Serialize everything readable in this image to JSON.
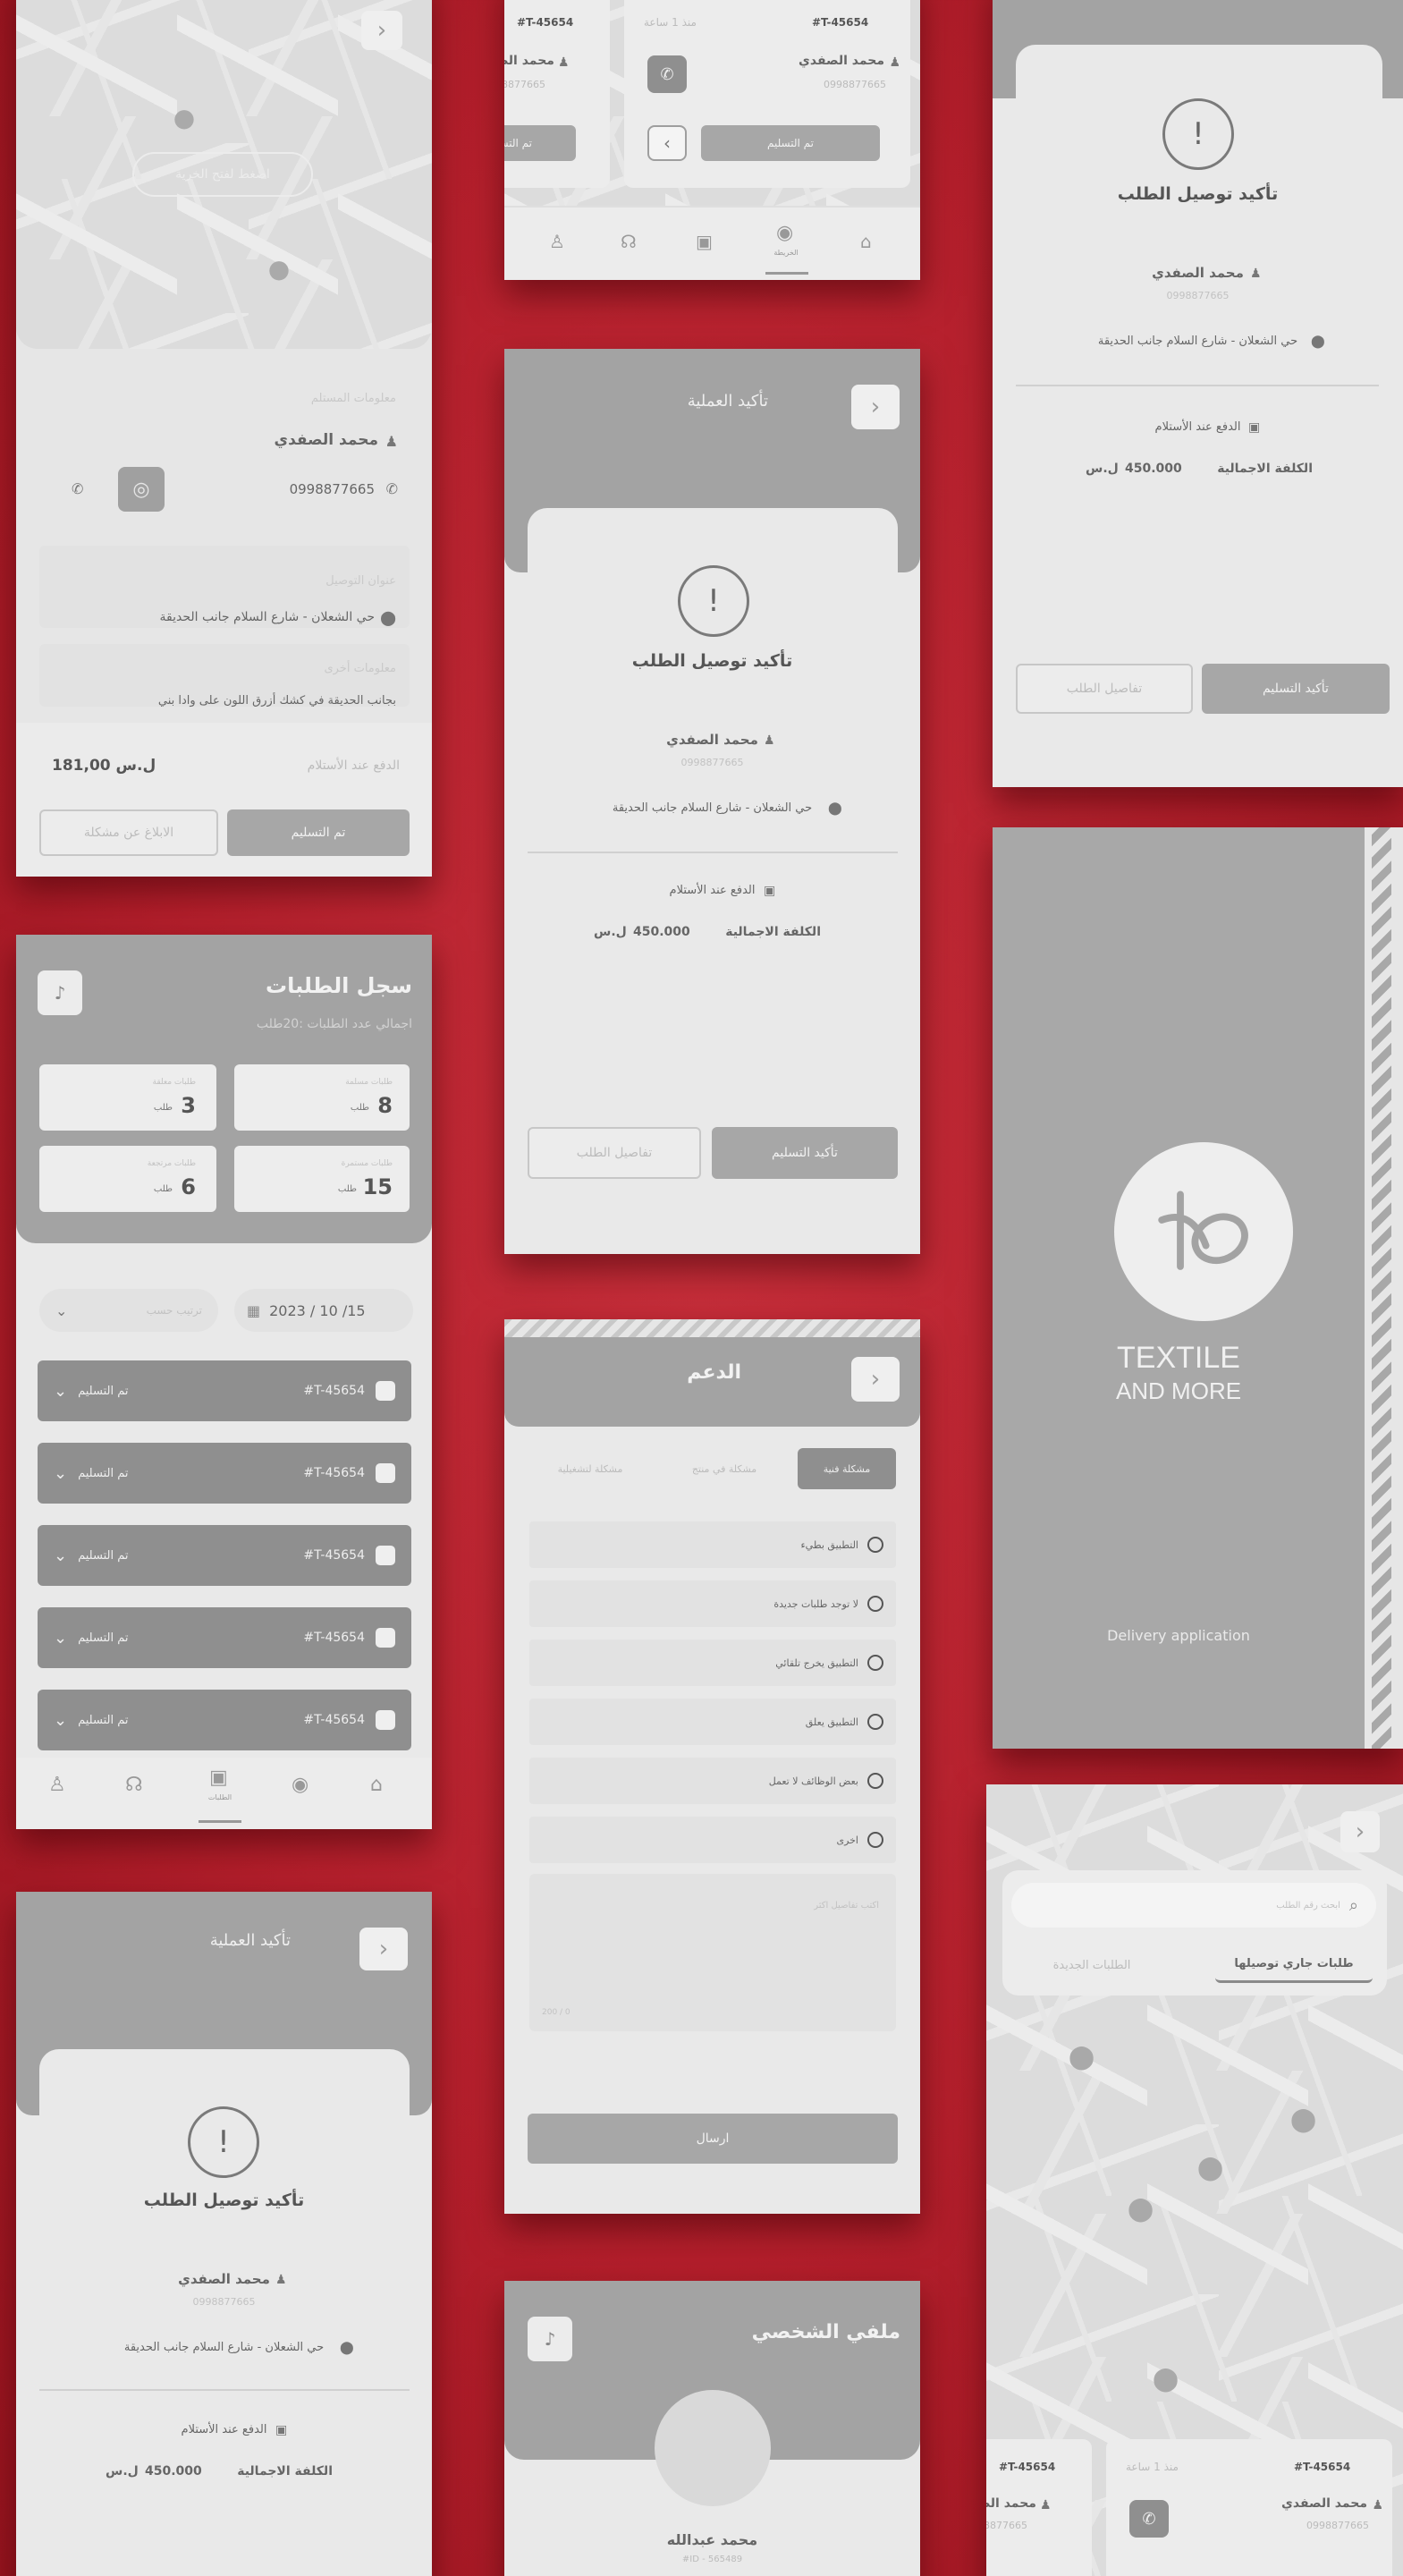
{
  "colors": {
    "background": "#b7222f",
    "panel": "#e8e8e8",
    "header": "#a3a3a3",
    "accent_dark": "#8f8f8f"
  },
  "icons": [
    "back-chevron-icon",
    "exclamation-icon",
    "user-icon",
    "location-pin-icon",
    "money-icon",
    "phone-icon",
    "whatsapp-icon",
    "bell-icon",
    "calendar-icon",
    "chevron-down-icon",
    "package-icon",
    "home-icon",
    "map-pin-icon",
    "orders-icon",
    "headset-icon",
    "profile-icon",
    "search-icon",
    "radio-icon",
    "textile-logo-icon"
  ],
  "shared": {
    "customer_name": "محمد الصفدي",
    "phone": "0998877665",
    "address": "حي الشعلان - شارع السلام جانب الحديقة",
    "payment": "الدفع عند الأستلام",
    "total_label": "الكلفة الاجمالية",
    "total_value": "450.000",
    "currency": "ل.س",
    "order_id": "#T-45654"
  },
  "s_map": {
    "center_button": "اضغط لفتح الخرية",
    "customer_info_label": "معلومات المستلم",
    "address_label": "عنوان التوصيل",
    "note_label": "معلومات أخرى",
    "note": "بجانب الحديقة في كشك أزرق اللون على وادا بني",
    "payment_label": "الدفع عند الأستلام",
    "amount": "181,00 ل.س",
    "deliver_button": "تم التسليم",
    "report_button": "الابلاغ عن مشكلة"
  },
  "s_confirm": {
    "title": "تأكيد العملية",
    "heading": "تأكيد توصيل الطلب",
    "confirm_button": "تأكيد التسليم",
    "details_button": "تفاصيل الطلب"
  },
  "s_orders": {
    "title": "سجل الطلبات",
    "subtitle": "اجمالي عدد الطلبات :20طلب",
    "unit": "طلب",
    "stats": [
      {
        "label": "طلبات مسلمة",
        "value": "8"
      },
      {
        "label": "طلبات معلقة",
        "value": "3"
      },
      {
        "label": "طلبات مستمرة",
        "value": "15"
      },
      {
        "label": "طلبات مرتجعة",
        "value": "6"
      }
    ],
    "date": "2023 / 10 /15",
    "sort_placeholder": "ترتيب حسب",
    "row_status": "تم التسليم",
    "rows": [
      "#T-45654",
      "#T-45654",
      "#T-45654",
      "#T-45654",
      "#T-45654"
    ],
    "nav_active": "الطلبات"
  },
  "s_support": {
    "title": "الدعم",
    "tabs": [
      "مشكلة فنية",
      "مشكلة في منتج",
      "مشكلة لتشغيلية"
    ],
    "options": [
      "التطبيق بطيء",
      "لا توجد طلبات جديدة",
      "التطبيق يخرج تلقائي",
      "التطبيق يعلق",
      "بعض الوظائف لا تعمل",
      "اخرى"
    ],
    "details_placeholder": "اكتب تفاصيل اكثر",
    "counter": "200 / 0",
    "send_button": "ارسال"
  },
  "s_profile": {
    "title": "ملفي الشخصي",
    "name": "محمد عبدالله",
    "id": "#ID - 565489"
  },
  "s_splash": {
    "brand_line1": "TEXTILE",
    "brand_line2": "AND MORE",
    "tagline": "Delivery application"
  },
  "s_top": {
    "time_ago": "منذ 1 ساعة",
    "deliver_button": "تم التسليم",
    "nav_active": "الخريطة"
  },
  "s_maplist": {
    "search_placeholder": "ابحث رقم الطلب",
    "tab_active": "طلبات جاري توصيلها",
    "tab_other": "الطلبات الجديدة"
  }
}
